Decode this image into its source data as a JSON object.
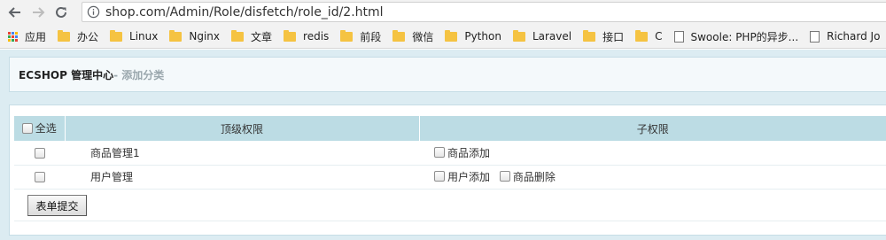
{
  "browser": {
    "url": "shop.com/Admin/Role/disfetch/role_id/2.html",
    "bookmarks": [
      "应用",
      "办公",
      "Linux",
      "Nginx",
      "文章",
      "redis",
      "前段",
      "微信",
      "Python",
      "Laravel",
      "接口",
      "C",
      "Swoole: PHP的异步...",
      "Richard Jo"
    ]
  },
  "header": {
    "site_title": "ECSHOP 管理中心",
    "sub_title": "- 添加分类"
  },
  "table": {
    "select_all": "全选",
    "col_top": "顶级权限",
    "col_sub": "子权限",
    "rows": [
      {
        "top": "商品管理1",
        "subs": [
          "商品添加"
        ]
      },
      {
        "top": "用户管理",
        "subs": [
          "用户添加",
          "商品删除"
        ]
      }
    ]
  },
  "form": {
    "submit_label": "表单提交"
  },
  "colors": {
    "page_bg": "#dcecf2",
    "table_header_bg": "#bcdce4",
    "header_panel_bg": "#f4f9fb"
  }
}
